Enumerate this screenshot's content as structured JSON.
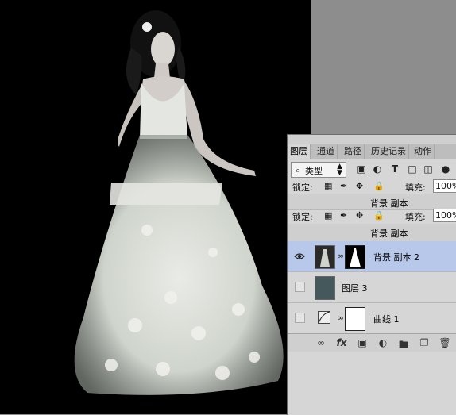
{
  "panel": {
    "tabs": [
      "图层",
      "通道",
      "路径",
      "历史记录",
      "动作"
    ],
    "filter": {
      "search_icon": "search-icon",
      "kind_label": "类型"
    },
    "lock_label": "锁定:",
    "fill_label": "填充:",
    "fill_value": "100%",
    "ghost_layer_name": "背景 副本",
    "layers": [
      {
        "name": "背景 副本 2",
        "visible": true,
        "selected": true,
        "has_mask": true
      },
      {
        "name": "图层 3",
        "visible": false,
        "selected": false,
        "color": "#45585b"
      },
      {
        "name": "曲线 1",
        "visible": false,
        "selected": false,
        "adjustment": "curves-icon"
      }
    ],
    "bottom_icons": [
      "link-icon",
      "fx-icon",
      "mask-icon",
      "adjustment-icon",
      "folder-icon",
      "new-layer-icon",
      "trash-icon"
    ],
    "fx_label": "fx"
  }
}
